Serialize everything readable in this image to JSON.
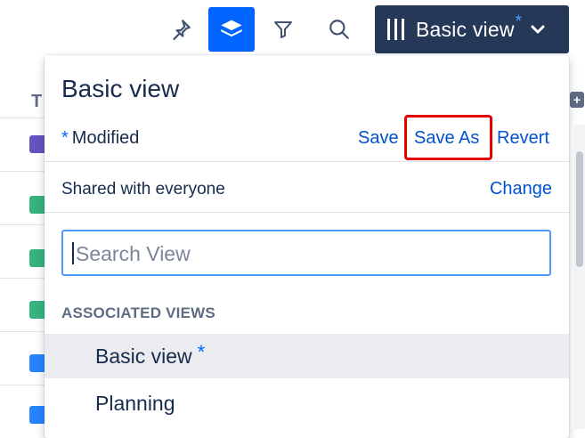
{
  "toolbar": {
    "pin_icon": "pin-icon",
    "layers_icon": "layers-icon",
    "filter_icon": "filter-icon",
    "search_icon": "search-icon",
    "view_switcher": {
      "label": "Basic view",
      "modified_mark": "*"
    }
  },
  "background": {
    "column_header": "T"
  },
  "popup": {
    "title": "Basic view",
    "modified_mark": "*",
    "modified_label": "Modified",
    "actions": {
      "save": "Save",
      "save_as": "Save As",
      "revert": "Revert"
    },
    "sharing": {
      "label": "Shared with everyone",
      "change": "Change"
    },
    "search": {
      "placeholder": "Search View",
      "value": ""
    },
    "section_header": "ASSOCIATED VIEWS",
    "views": [
      {
        "label": "Basic view",
        "modified_mark": "*",
        "selected": true
      },
      {
        "label": "Planning",
        "selected": false
      }
    ]
  },
  "colors": {
    "accent": "#0065ff",
    "switcher_bg": "#253858",
    "link": "#0052cc",
    "highlight": "#e80000"
  }
}
